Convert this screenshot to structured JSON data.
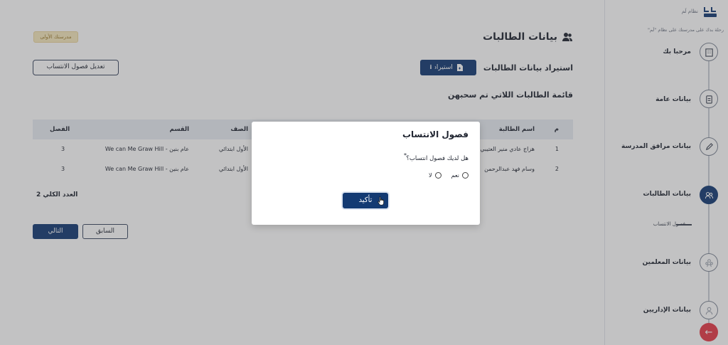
{
  "main": {
    "badge": "مدرستك الأولى",
    "page_title": "بيانات الطالبات",
    "import_label": "استيراد بيانات الطالبات",
    "import_button": "استيراد",
    "info_icon": "i",
    "edit_button": "تعديل فصول الانتساب",
    "list_title": "قائمة الطالبات اللاتي تم سحبهن",
    "table": {
      "headers": {
        "num": "م",
        "name": "اسم الطالبة",
        "grade": "الصف",
        "dept": "القسم",
        "class": "الفصل"
      },
      "rows": [
        {
          "num": "1",
          "name": "هزاج عادي منير العتيبي",
          "grade": "الأول ابتدائي",
          "dept": "عام بنين - We can Me Graw Hill",
          "class": "3"
        },
        {
          "num": "2",
          "name": "وسام فهد عبدالرحمن",
          "grade": "الأول ابتدائي",
          "dept": "عام بنين - We can Me Graw Hill",
          "class": "3"
        }
      ]
    },
    "total": "العدد الكلي 2",
    "next_button": "التالي",
    "prev_button": "السابق"
  },
  "sidebar": {
    "system_name": "نظام لَم",
    "welcome": "رحلة بدك على مدرستك على نظام \"لَم\"",
    "steps": [
      {
        "label": "مرحبا بك",
        "icon": "building-icon"
      },
      {
        "label": "بيانات عامة",
        "icon": "clipboard-icon"
      },
      {
        "label": "بيانات مرافق المدرسة",
        "icon": "pencil-icon"
      },
      {
        "label": "بيانات الطالبات",
        "icon": "students-icon"
      },
      {
        "label": "بيانات المعلمين",
        "icon": "teachers-icon"
      },
      {
        "label": "بيانات الإداريين",
        "icon": "admin-icon"
      }
    ],
    "substep": "فصول الانتساب"
  },
  "modal": {
    "title": "فصول الانتساب",
    "question": "هل لديك فصول انتساب؟",
    "required_mark": "*",
    "options": [
      "نعم",
      "لا"
    ],
    "confirm": "تأكيد"
  },
  "colors": {
    "primary": "#133a73",
    "danger": "#e63946",
    "badge_bg": "#f7e9be"
  }
}
